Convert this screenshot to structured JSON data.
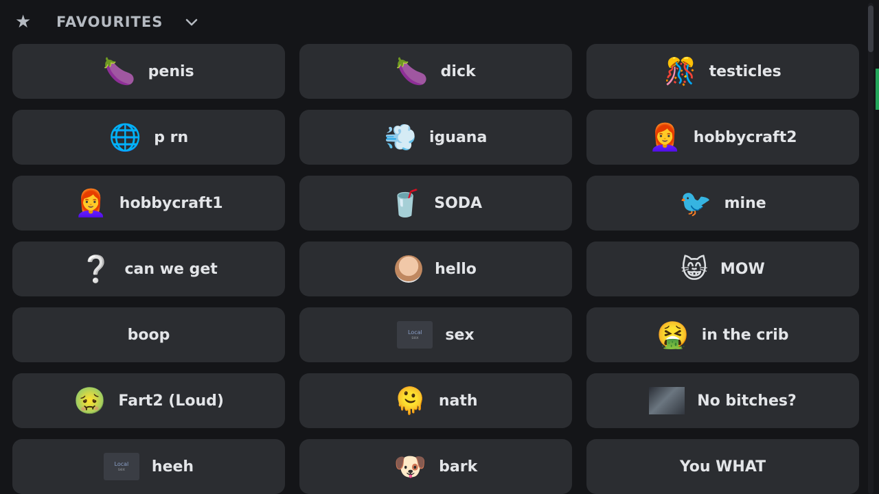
{
  "header": {
    "title": "FAVOURITES",
    "star_icon": "star-icon",
    "chevron_icon": "chevron-down-icon"
  },
  "sounds": [
    {
      "label": "penis",
      "emoji": "🍆",
      "icon": "eggplant-icon"
    },
    {
      "label": "dick",
      "emoji": "🍆",
      "icon": "eggplant-icon"
    },
    {
      "label": "testicles",
      "emoji": "🎊",
      "icon": "confetti-ball-icon"
    },
    {
      "label": "p  rn",
      "emoji": "🌐",
      "icon": "globe-icon"
    },
    {
      "label": "iguana",
      "emoji": "💨",
      "icon": "dash-icon"
    },
    {
      "label": "hobbycraft2",
      "emoji": "👩‍🦰",
      "icon": "red-haired-woman-icon"
    },
    {
      "label": "hobbycraft1",
      "emoji": "👩‍🦰",
      "icon": "red-haired-woman-icon"
    },
    {
      "label": "SODA",
      "emoji": "🥤",
      "icon": "cup-with-straw-icon"
    },
    {
      "label": "mine",
      "emoji": "🐦",
      "icon": "bird-icon"
    },
    {
      "label": "can we get",
      "emoji": "❔",
      "icon": "question-mark-icon"
    },
    {
      "label": "hello",
      "emoji": "",
      "icon": "custom-face-icon"
    },
    {
      "label": "MOW",
      "emoji": "😸",
      "icon": "grinning-cat-icon"
    },
    {
      "label": "boop",
      "emoji": "",
      "icon": ""
    },
    {
      "label": "sex",
      "emoji": "",
      "icon": "custom-image-icon",
      "image_text": "Local",
      "image_subtext": "sex"
    },
    {
      "label": "in the crib",
      "emoji": "🤮",
      "icon": "cowboy-vomiting-face-icon"
    },
    {
      "label": "Fart2 (Loud)",
      "emoji": "🤢",
      "icon": "disguised-face-icon"
    },
    {
      "label": "nath",
      "emoji": "🫠",
      "icon": "hugging-face-icon"
    },
    {
      "label": "No bitches?",
      "emoji": "",
      "icon": "custom-photo-icon"
    },
    {
      "label": "heeh",
      "emoji": "",
      "icon": "custom-image-icon",
      "image_text": "Local",
      "image_subtext": "sex"
    },
    {
      "label": "bark",
      "emoji": "🐶",
      "icon": "dog-face-icon"
    },
    {
      "label": "You WHAT",
      "emoji": "",
      "icon": ""
    }
  ],
  "colors": {
    "background": "#141518",
    "button": "#2b2d31",
    "text": "#e3e5e8",
    "accent": "#23a55a"
  }
}
